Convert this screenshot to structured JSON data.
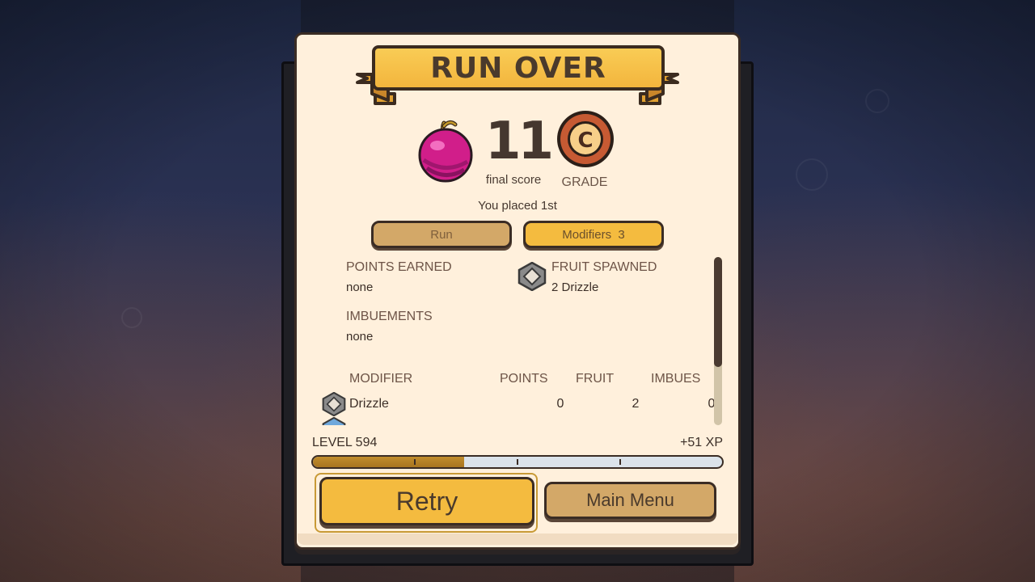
{
  "screen": {
    "title": "RUN OVER"
  },
  "score": {
    "value": "11",
    "label": "final score",
    "grade": "C",
    "grade_label": "GRADE",
    "placed": "You placed 1st",
    "fruit_icon": "pink-plum-icon"
  },
  "tabs": [
    {
      "label": "Run"
    },
    {
      "label": "Modifiers  3"
    }
  ],
  "summary": {
    "points_label": "POINTS EARNED",
    "points_value": "none",
    "fruit_label": "FRUIT SPAWNED",
    "fruit_value": "2 Drizzle",
    "imbue_label": "IMBUEMENTS",
    "imbue_value": "none"
  },
  "modifier_table": {
    "headers": [
      "MODIFIER",
      "POINTS",
      "FRUIT",
      "IMBUES"
    ],
    "rows": [
      {
        "name": "Drizzle",
        "points": "0",
        "fruit": "2",
        "imbues": "0",
        "icon": "drizzle-gem-icon"
      }
    ]
  },
  "xp": {
    "level": "LEVEL 594",
    "gain": "+51 XP",
    "progress": 0.37
  },
  "buttons": {
    "retry": "Retry",
    "main_menu": "Main Menu"
  },
  "colors": {
    "panel": "#fff0dc",
    "gold": "#f4bb3f",
    "tan": "#d3a868",
    "outline": "#3a2c24",
    "xp_fill": "#b07d24"
  }
}
